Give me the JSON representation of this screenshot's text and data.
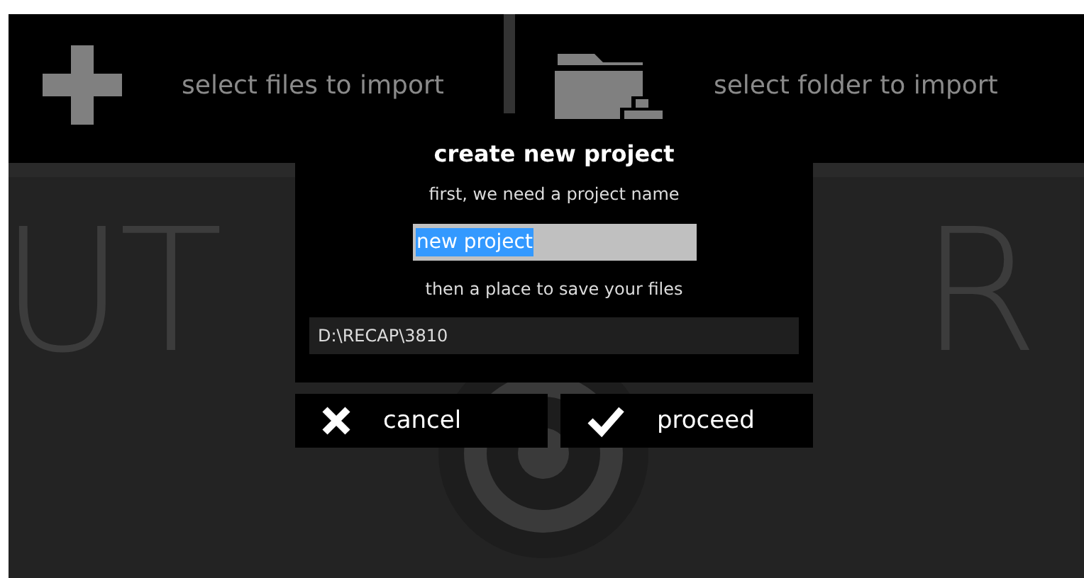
{
  "toolbar": {
    "items": [
      {
        "kind": "files",
        "label": "select files to import"
      },
      {
        "kind": "folder",
        "label": "select folder to import"
      }
    ]
  },
  "backdrop": {
    "letters": [
      "UT",
      "R"
    ]
  },
  "dialog": {
    "title": "create new project",
    "name_prompt": "first, we need a project name",
    "name_field": {
      "value": "new project",
      "selected": true
    },
    "path_prompt": "then a place to save your files",
    "path_field": {
      "value": "D:\\RECAP\\3810"
    }
  },
  "buttons": [
    {
      "kind": "cancel",
      "label": "cancel"
    },
    {
      "kind": "proceed",
      "label": "proceed"
    }
  ]
}
